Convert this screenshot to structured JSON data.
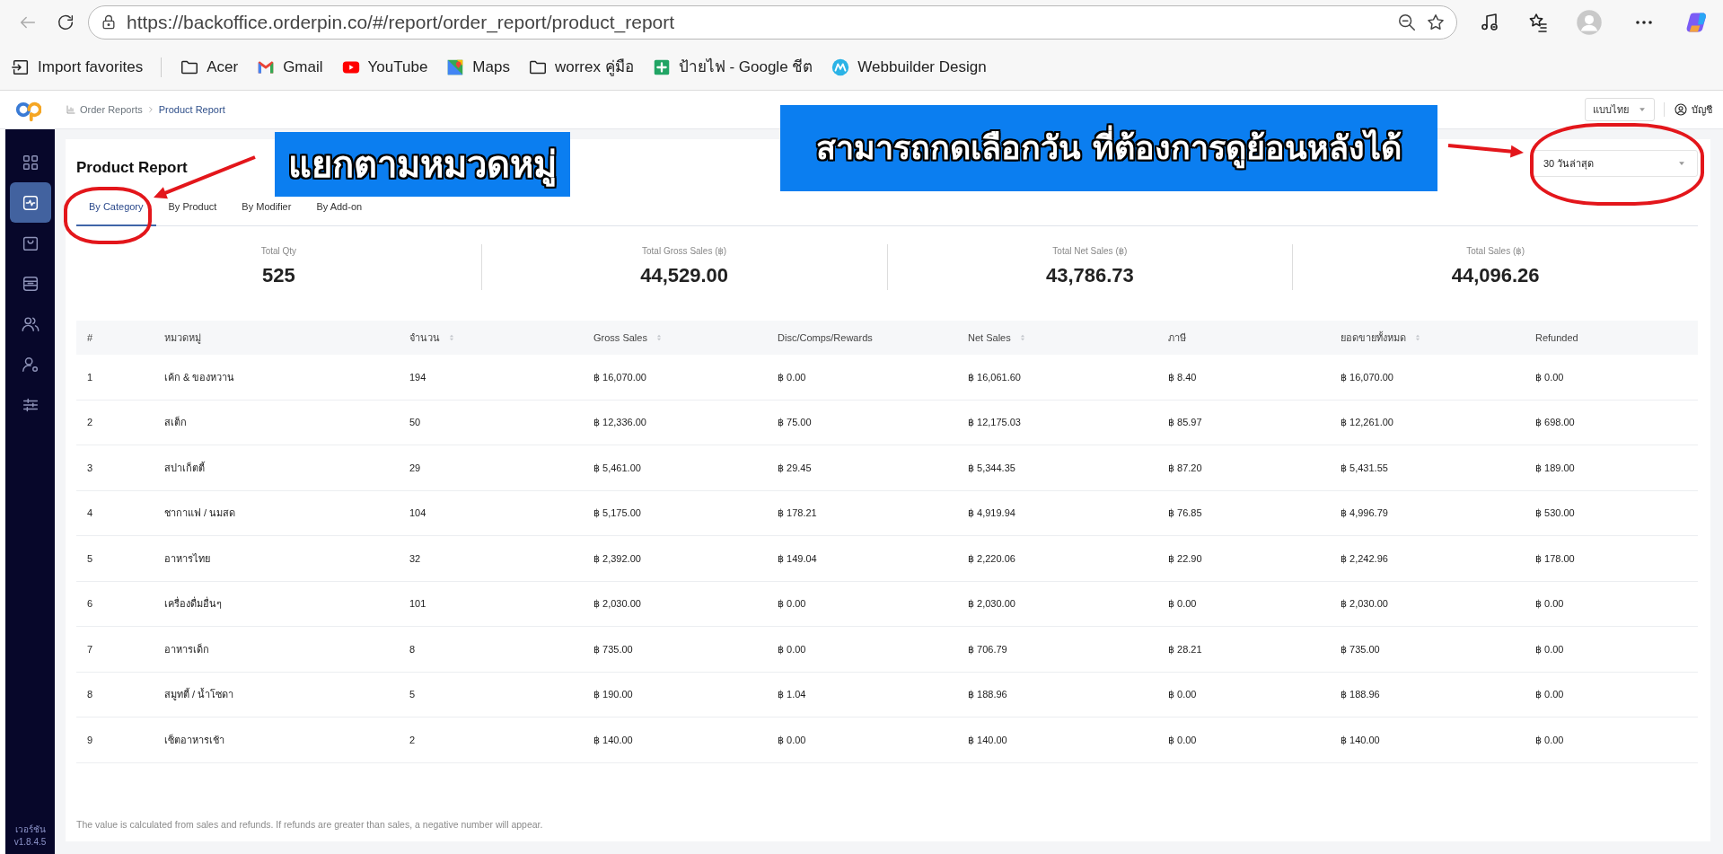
{
  "browser": {
    "url": "https://backoffice.orderpin.co/#/report/order_report/product_report",
    "bookmarks": [
      {
        "label": "Import favorites",
        "kind": "import"
      },
      {
        "label": "Acer",
        "kind": "folder"
      },
      {
        "label": "Gmail",
        "kind": "gmail"
      },
      {
        "label": "YouTube",
        "kind": "youtube"
      },
      {
        "label": "Maps",
        "kind": "maps"
      },
      {
        "label": "worrex คู่มือ",
        "kind": "folder"
      },
      {
        "label": "ป้ายไฟ - Google ชีต",
        "kind": "sheets"
      },
      {
        "label": "Webbuilder Design",
        "kind": "web"
      }
    ]
  },
  "app": {
    "breadcrumb": [
      "Order Reports",
      "Product Report"
    ],
    "language": "แบบไทย",
    "account": "บัญชี",
    "sidebar": {
      "items": [
        {
          "kind": "grid",
          "selected": false
        },
        {
          "kind": "activity",
          "selected": true
        },
        {
          "kind": "bag",
          "selected": false
        },
        {
          "kind": "archive",
          "selected": false
        },
        {
          "kind": "users",
          "selected": false
        },
        {
          "kind": "user-gear",
          "selected": false
        },
        {
          "kind": "sliders",
          "selected": false
        }
      ],
      "version": [
        "เวอร์ชัน",
        "v1.8.4.5"
      ]
    }
  },
  "report": {
    "title": "Product Report",
    "date_range": "30 วันล่าสุด",
    "tabs": [
      {
        "label": "By Category",
        "selected": true
      },
      {
        "label": "By Product",
        "selected": false
      },
      {
        "label": "By Modifier",
        "selected": false
      },
      {
        "label": "By Add-on",
        "selected": false
      }
    ],
    "stats": [
      {
        "label": "Total Qty",
        "value": "525"
      },
      {
        "label": "Total Gross Sales (฿)",
        "value": "44,529.00"
      },
      {
        "label": "Total Net Sales (฿)",
        "value": "43,786.73"
      },
      {
        "label": "Total Sales (฿)",
        "value": "44,096.26"
      }
    ],
    "table": {
      "columns": [
        {
          "label": "#",
          "sortable": false
        },
        {
          "label": "หมวดหมู่",
          "sortable": false
        },
        {
          "label": "จำนวน",
          "sortable": true
        },
        {
          "label": "Gross Sales",
          "sortable": true
        },
        {
          "label": "Disc/Comps/Rewards",
          "sortable": false
        },
        {
          "label": "Net Sales",
          "sortable": true
        },
        {
          "label": "ภาษี",
          "sortable": false
        },
        {
          "label": "ยอดขายทั้งหมด",
          "sortable": true
        },
        {
          "label": "Refunded",
          "sortable": false
        }
      ],
      "rows": [
        [
          "1",
          "เค้ก & ของหวาน",
          "194",
          "฿ 16,070.00",
          "฿ 0.00",
          "฿ 16,061.60",
          "฿ 8.40",
          "฿ 16,070.00",
          "฿ 0.00"
        ],
        [
          "2",
          "สเต็ก",
          "50",
          "฿ 12,336.00",
          "฿ 75.00",
          "฿ 12,175.03",
          "฿ 85.97",
          "฿ 12,261.00",
          "฿ 698.00"
        ],
        [
          "3",
          "สปาเก็ตตี้",
          "29",
          "฿ 5,461.00",
          "฿ 29.45",
          "฿ 5,344.35",
          "฿ 87.20",
          "฿ 5,431.55",
          "฿ 189.00"
        ],
        [
          "4",
          "ชากาแฟ / นมสด",
          "104",
          "฿ 5,175.00",
          "฿ 178.21",
          "฿ 4,919.94",
          "฿ 76.85",
          "฿ 4,996.79",
          "฿ 530.00"
        ],
        [
          "5",
          "อาหารไทย",
          "32",
          "฿ 2,392.00",
          "฿ 149.04",
          "฿ 2,220.06",
          "฿ 22.90",
          "฿ 2,242.96",
          "฿ 178.00"
        ],
        [
          "6",
          "เครื่องดื่มอื่นๆ",
          "101",
          "฿ 2,030.00",
          "฿ 0.00",
          "฿ 2,030.00",
          "฿ 0.00",
          "฿ 2,030.00",
          "฿ 0.00"
        ],
        [
          "7",
          "อาหารเด็ก",
          "8",
          "฿ 735.00",
          "฿ 0.00",
          "฿ 706.79",
          "฿ 28.21",
          "฿ 735.00",
          "฿ 0.00"
        ],
        [
          "8",
          "สมูทตี้ / น้ำโซดา",
          "5",
          "฿ 190.00",
          "฿ 1.04",
          "฿ 188.96",
          "฿ 0.00",
          "฿ 188.96",
          "฿ 0.00"
        ],
        [
          "9",
          "เซ็ตอาหารเช้า",
          "2",
          "฿ 140.00",
          "฿ 0.00",
          "฿ 140.00",
          "฿ 0.00",
          "฿ 140.00",
          "฿ 0.00"
        ]
      ]
    },
    "footnote": "The value is calculated from sales and refunds. If refunds are greater than sales, a negative number will appear."
  },
  "annotations": [
    {
      "text": "แยกตามหมวดหมู่"
    },
    {
      "text": "สามารถกดเลือกวัน ที่ต้องการดูย้อนหลังได้"
    }
  ]
}
